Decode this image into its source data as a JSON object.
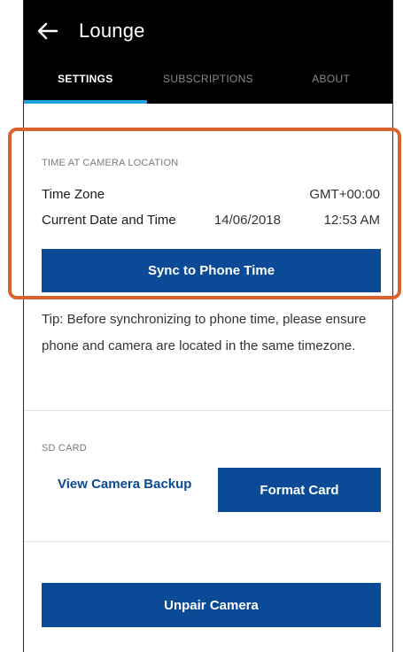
{
  "header": {
    "title": "Lounge",
    "back_icon": "arrow-left-icon"
  },
  "tabs": [
    {
      "label": "SETTINGS",
      "active": true
    },
    {
      "label": "SUBSCRIPTIONS",
      "active": false
    },
    {
      "label": "ABOUT",
      "active": false
    }
  ],
  "time_section": {
    "label": "TIME AT CAMERA LOCATION",
    "time_zone_label": "Time Zone",
    "time_zone_value": "GMT+00:00",
    "datetime_label": "Current Date and Time",
    "date_value": "14/06/2018",
    "time_value": "12:53 AM",
    "sync_button": "Sync to Phone Time",
    "tip": "Tip: Before synchronizing to phone time, please ensure phone and camera are located in the same timezone."
  },
  "sd_section": {
    "label": "SD CARD",
    "view_backup": "View Camera Backup",
    "format_card": "Format Card"
  },
  "unpair_button": "Unpair Camera",
  "colors": {
    "header_bg": "#000000",
    "tab_indicator": "#1fa3e0",
    "primary_button": "#0a4a97",
    "highlight_border": "#d9632c"
  }
}
